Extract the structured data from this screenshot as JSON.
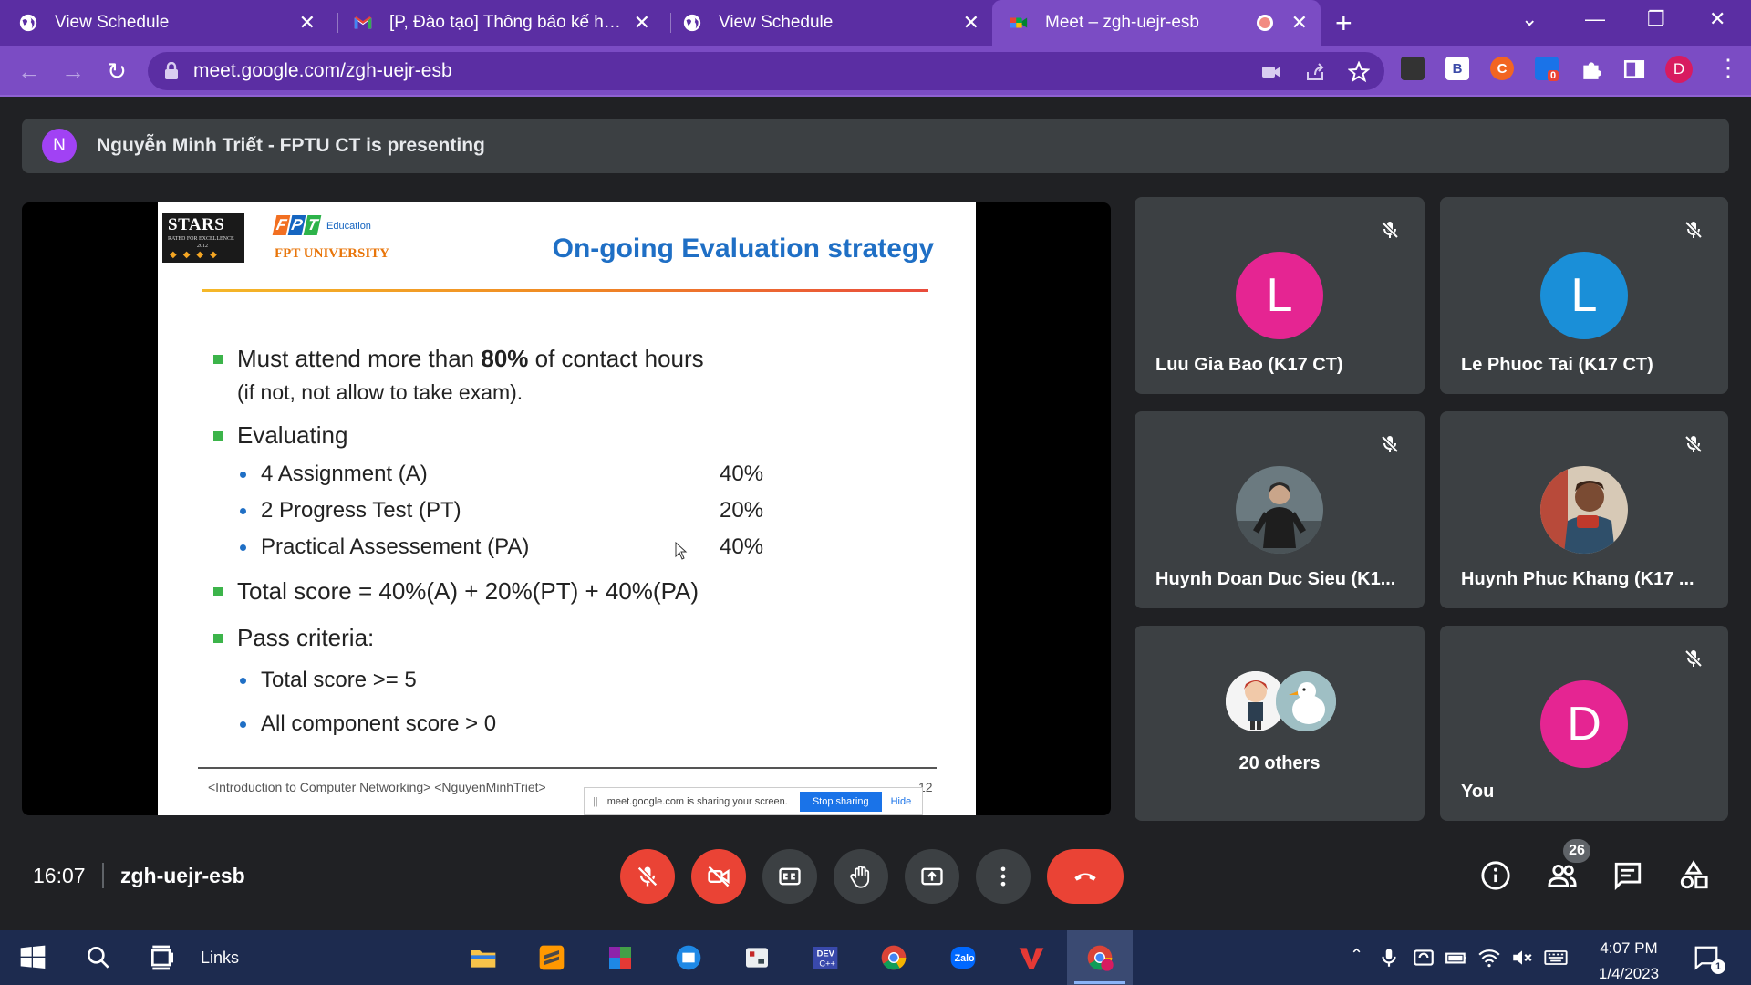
{
  "browser": {
    "tabs": [
      {
        "title": "View Schedule",
        "icon": "globe-icon"
      },
      {
        "title": "[P, Đào tạo] Thông báo kế hoạch",
        "icon": "gmail-icon"
      },
      {
        "title": "View Schedule",
        "icon": "globe-icon"
      },
      {
        "title": "Meet – zgh-uejr-esb",
        "icon": "meet-icon",
        "active": true,
        "recording": true
      }
    ],
    "url": "meet.google.com/zgh-uejr-esb",
    "profile_initial": "D",
    "extensions": [
      {
        "name": "b-extension",
        "label": "B"
      },
      {
        "name": "c-extension",
        "label": "C"
      },
      {
        "name": "badge-extension",
        "badge": "0"
      }
    ]
  },
  "meet": {
    "presenter_initial": "N",
    "presenting_text": "Nguyễn Minh Triết - FPTU CT is presenting",
    "slide": {
      "stars_logo": "STARS",
      "stars_sub": "RATED FOR EXCELLENCE",
      "stars_year": "2012",
      "fpt_mark": [
        "F",
        "P",
        "T"
      ],
      "fpt_education": "Education",
      "fpt_university": "FPT UNIVERSITY",
      "title": "On-going Evaluation strategy",
      "bullet1_pre": "Must attend more than ",
      "bullet1_bold": "80%",
      "bullet1_post": " of contact hours",
      "bullet1_cont": "(if not, not allow to take exam).",
      "bullet2": "Evaluating",
      "evaluating": [
        {
          "item": "4 Assignment (A)",
          "pct": "40%"
        },
        {
          "item": "2 Progress Test (PT)",
          "pct": "20%"
        },
        {
          "item": "Practical Assessement (PA)",
          "pct": "40%"
        }
      ],
      "bullet3": "Total score = 40%(A) + 20%(PT) + 40%(PA)",
      "bullet4": "Pass criteria:",
      "criteria": [
        "Total score >= 5",
        "All component score > 0"
      ],
      "footer": "<Introduction to Computer Networking> <NguyenMinhTriet>",
      "page_number": "12"
    },
    "sharing_bar": {
      "grip": "||",
      "message": "meet.google.com is sharing your screen.",
      "stop": "Stop sharing",
      "hide": "Hide"
    },
    "participants": [
      {
        "name": "Luu Gia Bao (K17 CT)",
        "initial": "L",
        "color": "#e52592",
        "muted": true
      },
      {
        "name": "Le Phuoc Tai (K17 CT)",
        "initial": "L",
        "color": "#1a8fd8",
        "muted": true
      },
      {
        "name": "Huynh Doan Duc Sieu (K1...",
        "photo": true,
        "muted": true
      },
      {
        "name": "Huynh Phuc Khang (K17 ...",
        "photo": true,
        "muted": true
      },
      {
        "name": "You",
        "initial": "D",
        "color": "#e52592",
        "muted": true
      }
    ],
    "others_label": "20 others",
    "time": "16:07",
    "meeting_code": "zgh-uejr-esb",
    "people_count": "26"
  },
  "taskbar": {
    "search_label": "Links",
    "clock_time": "4:07 PM",
    "clock_date": "1/4/2023",
    "notification_count": "1"
  },
  "colors": {
    "tab_bar": "#5b2ea3",
    "toolbar": "#7b4cc4",
    "meet_bg": "#202124",
    "tile": "#3c4043",
    "danger": "#ea4335",
    "taskbar": "#1d2b4f"
  }
}
